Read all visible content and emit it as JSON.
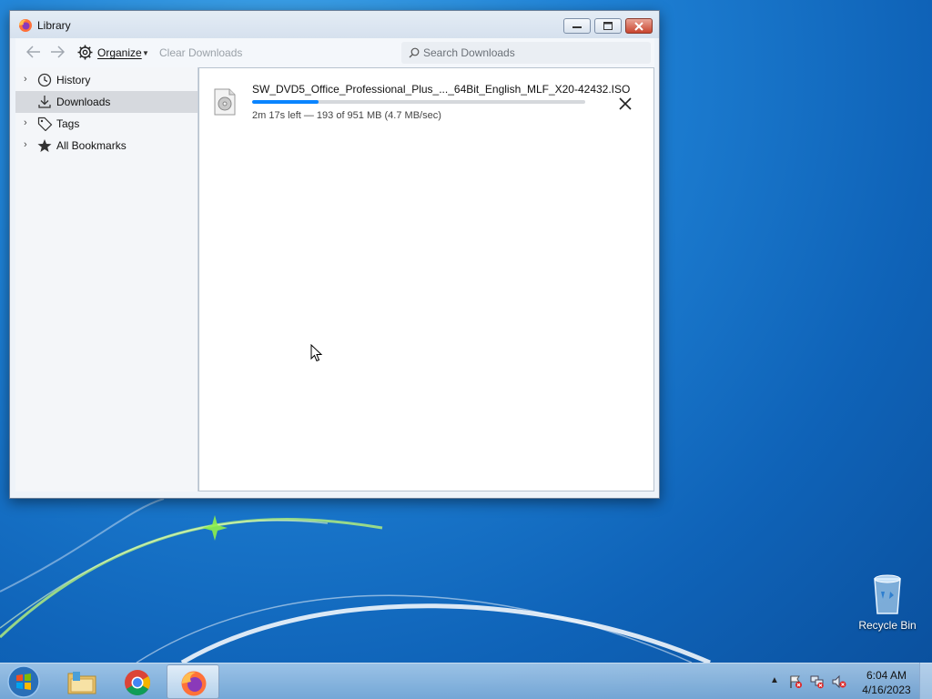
{
  "window": {
    "title": "Library"
  },
  "toolbar": {
    "organize_label": "Organize",
    "clear_label": "Clear Downloads",
    "search_placeholder": "Search Downloads"
  },
  "sidebar": {
    "items": [
      {
        "label": "History",
        "icon": "clock-icon",
        "expandable": true,
        "selected": false
      },
      {
        "label": "Downloads",
        "icon": "download-icon",
        "expandable": false,
        "selected": true
      },
      {
        "label": "Tags",
        "icon": "tag-icon",
        "expandable": true,
        "selected": false
      },
      {
        "label": "All Bookmarks",
        "icon": "star-icon",
        "expandable": true,
        "selected": false
      }
    ]
  },
  "downloads": [
    {
      "name": "SW_DVD5_Office_Professional_Plus_..._64Bit_English_MLF_X20-42432.ISO",
      "status": "2m 17s left — 193 of 951 MB (4.7 MB/sec)",
      "progress_percent": 20
    }
  ],
  "desktop": {
    "recycle_bin_label": "Recycle Bin"
  },
  "taskbar": {
    "apps": [
      "windows-explorer",
      "google-chrome",
      "firefox"
    ],
    "active_app": "firefox",
    "time": "6:04 AM",
    "date": "4/16/2023"
  },
  "colors": {
    "progress": "#0a84ff",
    "selected_bg": "#d6d9de"
  }
}
